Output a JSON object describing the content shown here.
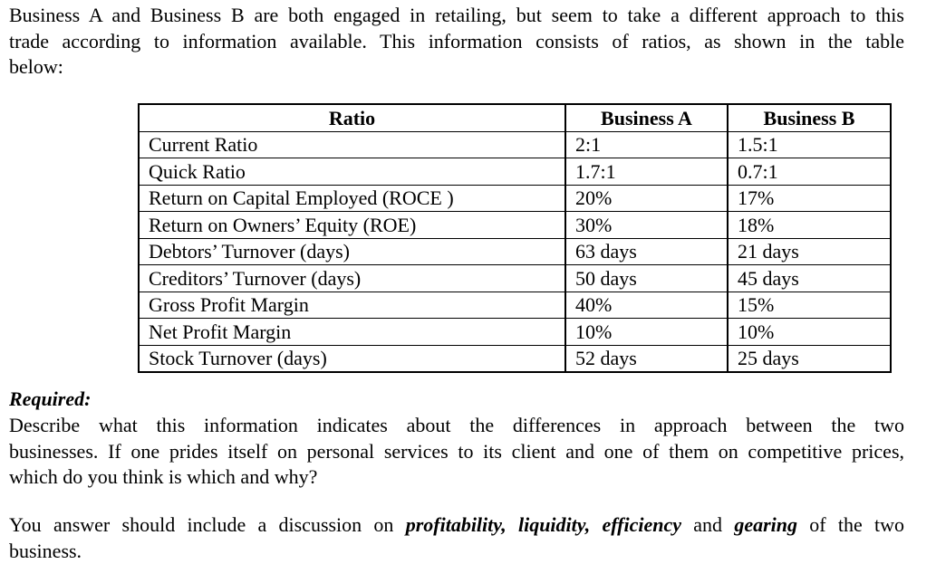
{
  "intro": {
    "lines": [
      "Business A and Business B are both engaged in retailing, but seem to take a different approach to this",
      "trade according to information available. This information consists of ratios, as shown in the table",
      "below:"
    ]
  },
  "table": {
    "headers": [
      "Ratio",
      "Business A",
      "Business B"
    ],
    "rows": [
      {
        "ratio": "Current Ratio",
        "a": "2:1",
        "b": "1.5:1"
      },
      {
        "ratio": "Quick Ratio",
        "a": "1.7:1",
        "b": "0.7:1"
      },
      {
        "ratio": "Return on Capital Employed (ROCE )",
        "a": "20%",
        "b": "17%"
      },
      {
        "ratio": "Return on Owners’ Equity (ROE)",
        "a": "30%",
        "b": "18%"
      },
      {
        "ratio": "Debtors’ Turnover (days)",
        "a": "63 days",
        "b": "21 days"
      },
      {
        "ratio": "Creditors’ Turnover (days)",
        "a": "50 days",
        "b": "45 days"
      },
      {
        "ratio": "Gross Profit Margin",
        "a": "40%",
        "b": "15%"
      },
      {
        "ratio": "Net Profit Margin",
        "a": "10%",
        "b": "10%"
      },
      {
        "ratio": "Stock Turnover (days)",
        "a": "52 days",
        "b": "25 days"
      }
    ]
  },
  "required": {
    "heading": "Required:",
    "lines": [
      "Describe what this information indicates about the differences in approach between the two",
      "businesses. If one prides itself on personal services to its client and one of them on competitive prices,",
      "which do you think is which and why?"
    ]
  },
  "answer_note": {
    "prefix": "You answer should include a discussion on ",
    "term1": "profitability, liquidity, efficiency",
    "middle": " and ",
    "term2": "gearing",
    "suffix": " of the two",
    "last_line": "business."
  }
}
